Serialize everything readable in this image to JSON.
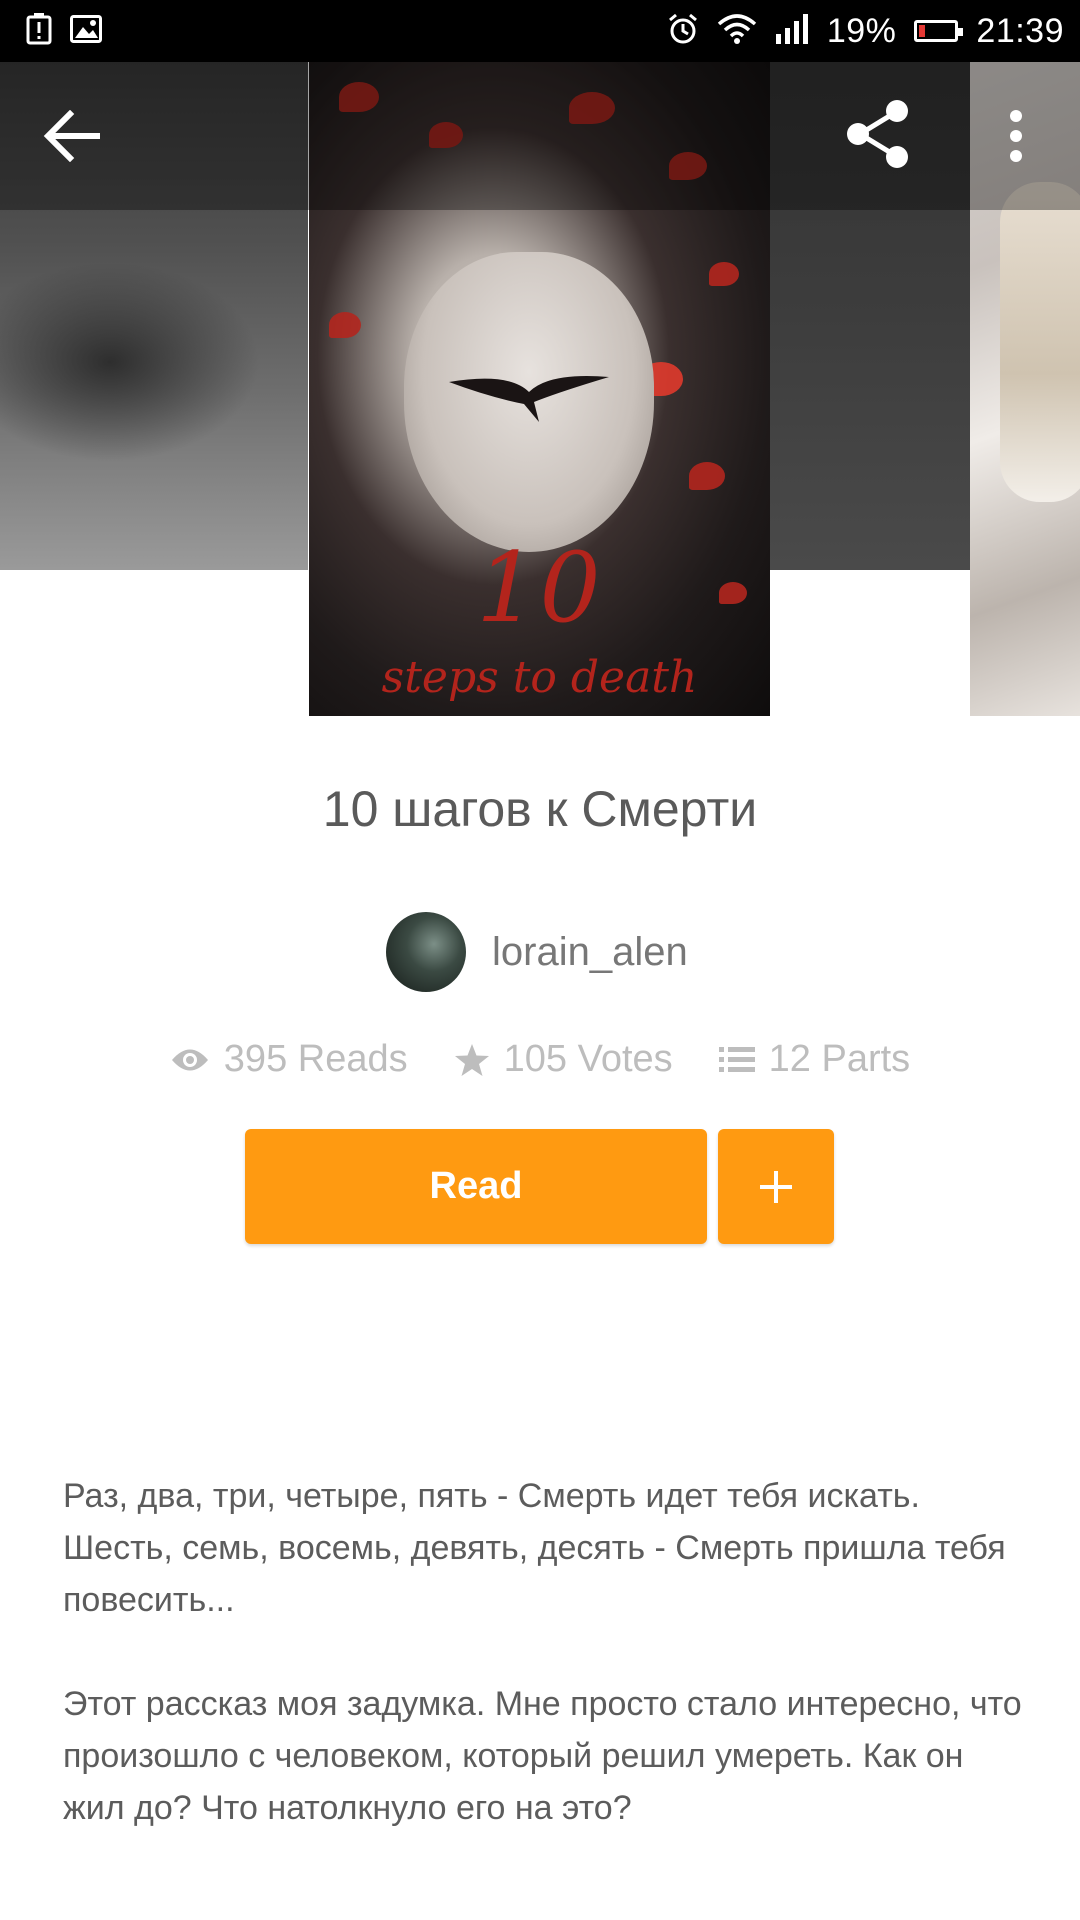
{
  "status_bar": {
    "battery_percent": "19%",
    "time": "21:39",
    "icons": [
      "alert-icon",
      "image-icon",
      "alarm-icon",
      "wifi-icon",
      "signal-icon",
      "battery-icon"
    ],
    "battery_level": 0.19,
    "battery_color": "#e53935"
  },
  "toolbar": {
    "icons": [
      "back-arrow-icon",
      "share-icon",
      "more-vert-icon"
    ]
  },
  "cover": {
    "number_text": "10",
    "subtitle_text": "steps to death"
  },
  "story": {
    "title": "10 шагов к Смерти",
    "author": "lorain_alen",
    "reads": "395 Reads",
    "votes": "105 Votes",
    "parts": "12 Parts",
    "read_label": "Read",
    "add_label": "+",
    "description": [
      "Раз, два, три, четыре, пять - Смерть идет тебя искать. Шесть, семь, восемь, девять, десять - Смерть пришла тебя повесить...",
      "Этот рассказ моя задумка. Мне просто стало интересно, что произошло с человеком, который решил умереть. Как он жил до? Что натолкнуло его на это?"
    ]
  },
  "colors": {
    "accent": "#ff9a11",
    "title_text": "#5a5a5a",
    "stat_text": "#bdbdbd"
  }
}
